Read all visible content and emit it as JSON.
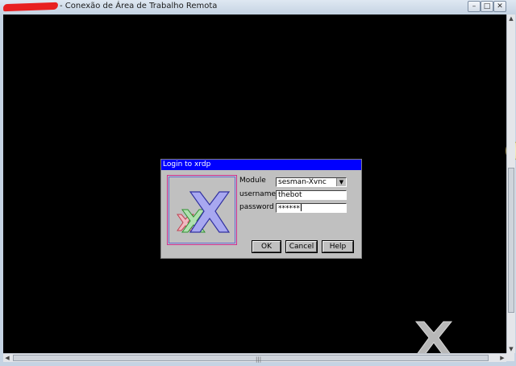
{
  "window": {
    "title": "- Conexão de Área de Trabalho Remota",
    "buttons": {
      "minimize": "–",
      "maximize": "□",
      "close": "✕"
    }
  },
  "login_dialog": {
    "title": "Login to xrdp",
    "module_label": "Module",
    "module_value": "sesman-Xvnc",
    "username_label": "username",
    "username_value": "thebot",
    "password_label": "password",
    "password_value": "******",
    "ok_label": "OK",
    "cancel_label": "Cancel",
    "help_label": "Help"
  },
  "scrollbars": {
    "up": "▲",
    "down": "▼",
    "left": "◀",
    "right": "▶",
    "grip": "|||"
  },
  "icons": [
    "xrdp-logo-icon",
    "dropdown-arrow-icon",
    "background-x-logo-icon"
  ],
  "colors": {
    "dialog_title_bg": "#0000ff",
    "dialog_bg": "#c0c0c0",
    "desktop_bg": "#000000"
  }
}
